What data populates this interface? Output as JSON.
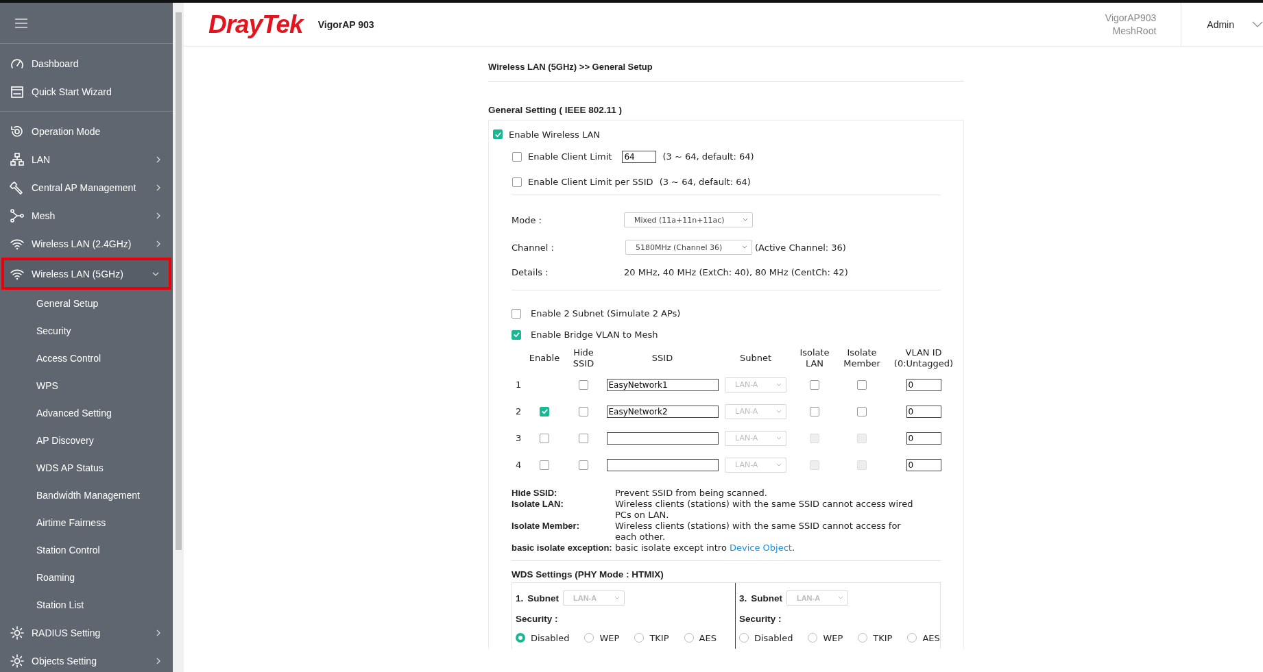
{
  "sidebar": {
    "sections": [
      [
        {
          "label": "Dashboard",
          "kind": "gauge",
          "selected": false
        },
        {
          "label": "Quick Start Wizard",
          "kind": "wizard",
          "selected": false
        }
      ],
      [
        {
          "label": "Operation Mode",
          "kind": "mode",
          "selected": false
        },
        {
          "label": "LAN",
          "kind": "network",
          "selected": false,
          "expanded": false
        },
        {
          "label": "Central AP Management",
          "kind": "wrench",
          "selected": false,
          "expanded": false
        },
        {
          "label": "Mesh",
          "kind": "mesh",
          "selected": false,
          "expanded": false
        },
        {
          "label": "Wireless LAN (2.4GHz)",
          "kind": "wifi",
          "selected": false,
          "expanded": false
        },
        {
          "label": "Wireless LAN (5GHz)",
          "kind": "wifi",
          "selected": true,
          "expanded": true,
          "children": [
            {
              "label": "General Setup",
              "selected": false
            },
            {
              "label": "Security",
              "selected": false
            },
            {
              "label": "Access Control",
              "selected": false
            },
            {
              "label": "WPS",
              "selected": false
            },
            {
              "label": "Advanced Setting",
              "selected": false
            },
            {
              "label": "AP Discovery",
              "selected": false
            },
            {
              "label": "WDS AP Status",
              "selected": false
            },
            {
              "label": "Bandwidth Management",
              "selected": false
            },
            {
              "label": "Airtime Fairness",
              "selected": false
            },
            {
              "label": "Station Control",
              "selected": false
            },
            {
              "label": "Roaming",
              "selected": false
            },
            {
              "label": "Station List",
              "selected": false
            }
          ]
        },
        {
          "label": "RADIUS Setting",
          "kind": "gear",
          "selected": false,
          "expanded": false
        },
        {
          "label": "Objects Setting",
          "kind": "gear",
          "selected": false,
          "expanded": false
        }
      ]
    ]
  },
  "header": {
    "logo": "DrayTek",
    "model": "VigorAP 903",
    "device_name": "VigorAP903",
    "device_role": "MeshRoot",
    "user": "Admin"
  },
  "breadcrumb": "Wireless LAN (5GHz) >> General Setup",
  "section_title": "General Setting ( IEEE 802.11 )",
  "enable_wireless_lan": {
    "label": "Enable Wireless LAN",
    "checked": true
  },
  "client_limit": {
    "label": "Enable Client Limit",
    "checked": false,
    "value": "64",
    "hint": "(3 ~ 64, default: 64)"
  },
  "client_limit_per_ssid": {
    "label": "Enable Client Limit per SSID",
    "checked": false,
    "hint": "(3 ~ 64, default: 64)"
  },
  "mode": {
    "label": "Mode :",
    "value": "Mixed (11a+11n+11ac)"
  },
  "channel": {
    "label": "Channel :",
    "value": "5180MHz (Channel 36)",
    "note": "(Active Channel: 36)"
  },
  "details": {
    "label": "Details :",
    "value": "20 MHz, 40 MHz (ExtCh: 40), 80 MHz (CentCh: 42)"
  },
  "enable_2_subnet": {
    "label": "Enable 2 Subnet (Simulate 2 APs)",
    "checked": false
  },
  "bridge_vlan": {
    "label": "Enable Bridge VLAN to Mesh",
    "checked": true
  },
  "ssid_table": {
    "columns": [
      "Enable",
      "Hide SSID",
      "SSID",
      "Subnet",
      "Isolate LAN",
      "Isolate Member",
      "VLAN ID (0:Untagged)"
    ],
    "rows": [
      {
        "index": "1",
        "hide_ssid": false,
        "ssid": "EasyNetwork1",
        "subnet": "LAN-A",
        "isolate_lan": {
          "checked": false,
          "disabled": false
        },
        "isolate_member": {
          "checked": false,
          "disabled": false
        },
        "vlan_id": "0"
      },
      {
        "index": "2",
        "enable": true,
        "hide_ssid": false,
        "ssid": "EasyNetwork2",
        "subnet": "LAN-A",
        "isolate_lan": {
          "checked": false,
          "disabled": false
        },
        "isolate_member": {
          "checked": false,
          "disabled": false
        },
        "vlan_id": "0"
      },
      {
        "index": "3",
        "enable": false,
        "hide_ssid": false,
        "subnet": "LAN-A",
        "isolate_lan": {
          "checked": false,
          "disabled": true
        },
        "isolate_member": {
          "checked": false,
          "disabled": true
        },
        "vlan_id": "0"
      },
      {
        "index": "4",
        "enable": false,
        "hide_ssid": false,
        "subnet": "LAN-A",
        "isolate_lan": {
          "checked": false,
          "disabled": true
        },
        "isolate_member": {
          "checked": false,
          "disabled": true
        },
        "vlan_id": "0"
      }
    ]
  },
  "notes": [
    {
      "term": "Hide SSID:",
      "text": "Prevent SSID from being scanned."
    },
    {
      "term": "Isolate LAN:",
      "text": "Wireless clients (stations) with the same SSID cannot access wired PCs on LAN."
    },
    {
      "term": "Isolate Member:",
      "text": "Wireless clients (stations) with the same SSID cannot access for each other."
    },
    {
      "term": "basic isolate exception:",
      "text": "basic isolate except intro ",
      "link": "Device Object",
      "after": "."
    }
  ],
  "wds": {
    "title": "WDS Settings (PHY Mode : HTMIX)",
    "panels": [
      {
        "number": "1.",
        "subnet_label": "Subnet",
        "subnet": "LAN-A",
        "security_label": "Security :",
        "options": [
          {
            "label": "Disabled",
            "selected": true
          },
          {
            "label": "WEP",
            "selected": false
          },
          {
            "label": "TKIP",
            "selected": false
          },
          {
            "label": "AES",
            "selected": false
          }
        ]
      },
      {
        "number": "3.",
        "subnet_label": "Subnet",
        "subnet": "LAN-A",
        "security_label": "Security :",
        "options": [
          {
            "label": "Disabled",
            "selected": false
          },
          {
            "label": "WEP",
            "selected": false
          },
          {
            "label": "TKIP",
            "selected": false
          },
          {
            "label": "AES",
            "selected": false
          }
        ]
      }
    ]
  }
}
